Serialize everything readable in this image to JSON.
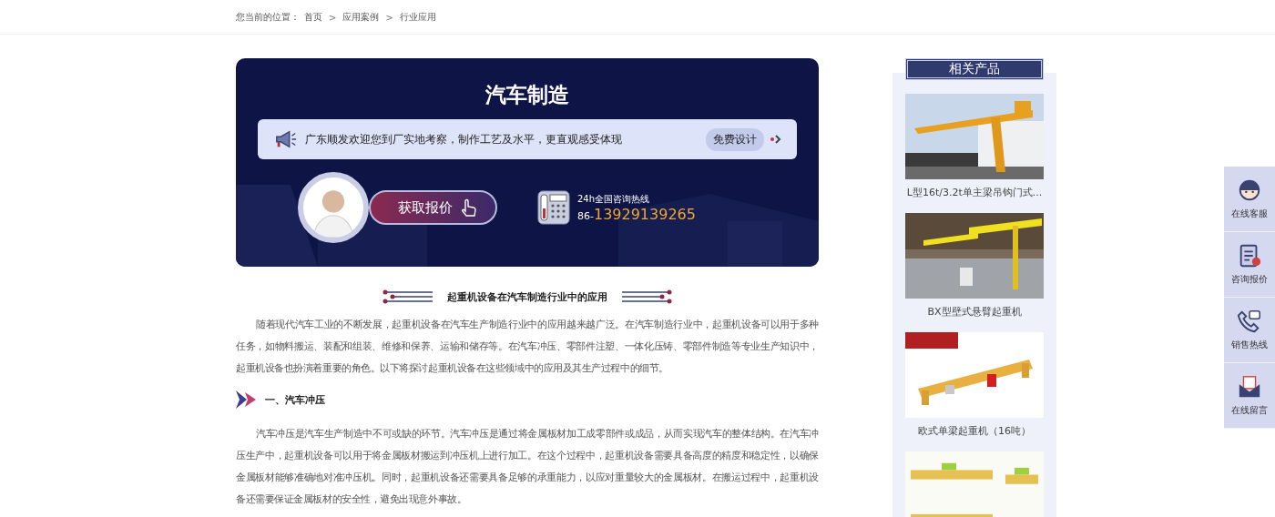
{
  "breadcrumb": {
    "label": "您当前的位置：",
    "items": [
      {
        "kind": "link",
        "text": "首页"
      },
      {
        "kind": "separator",
        "text": ">"
      },
      {
        "kind": "link",
        "text": "应用案例"
      },
      {
        "kind": "separator",
        "text": ">"
      },
      {
        "kind": "link",
        "text": "行业应用"
      }
    ]
  },
  "banner": {
    "title": "汽车制造",
    "notice": "广东顺发欢迎您到厂实地考察，制作工艺及水平，更直观感受体现",
    "notice_button": "免费设计",
    "quote_button": "获取报价",
    "hotline_label": "24h全国咨询热线",
    "hotline_prefix": "86-",
    "hotline_number": "13929139265"
  },
  "article": {
    "title": "起重机设备在汽车制造行业中的应用",
    "blocks": [
      {
        "kind": "paragraph",
        "text": "随着现代汽车工业的不断发展，起重机设备在汽车生产制造行业中的应用越来越广泛。在汽车制造行业中，起重机设备可以用于多种任务，如物料搬运、装配和组装、维修和保养、运输和储存等。在汽车冲压、零部件注塑、一体化压铸、零部件制造等专业生产知识中，起重机设备也扮演着重要的角色。以下将探讨起重机设备在这些领域中的应用及其生产过程中的细节。"
      },
      {
        "kind": "heading",
        "text": "一、汽车冲压"
      },
      {
        "kind": "paragraph",
        "text": "汽车冲压是汽车生产制造中不可或缺的环节。汽车冲压是通过将金属板材加工成零部件或成品，从而实现汽车的整体结构。在汽车冲压生产中，起重机设备可以用于将金属板材搬运到冲压机上进行加工。在这个过程中，起重机设备需要具备高度的精度和稳定性，以确保金属板材能够准确地对准冲压机。同时，起重机设备还需要具备足够的承重能力，以应对重量较大的金属板材。在搬运过程中，起重机设备还需要保证金属板材的安全性，避免出现意外事故。"
      }
    ]
  },
  "sidebar": {
    "title": "相关产品",
    "products": [
      {
        "kind": "product",
        "caption": "L型16t/3.2t单主梁吊钩门式..."
      },
      {
        "kind": "product",
        "caption": "BX型壁式悬臂起重机"
      },
      {
        "kind": "product",
        "caption": "欧式单梁起重机（16吨）"
      },
      {
        "kind": "picture"
      }
    ]
  },
  "dock": [
    {
      "label": "在线客服",
      "kind": "agent"
    },
    {
      "label": "咨询报价",
      "kind": "quote"
    },
    {
      "label": "销售热线",
      "kind": "phone"
    },
    {
      "label": "在线留言",
      "kind": "mail"
    }
  ]
}
